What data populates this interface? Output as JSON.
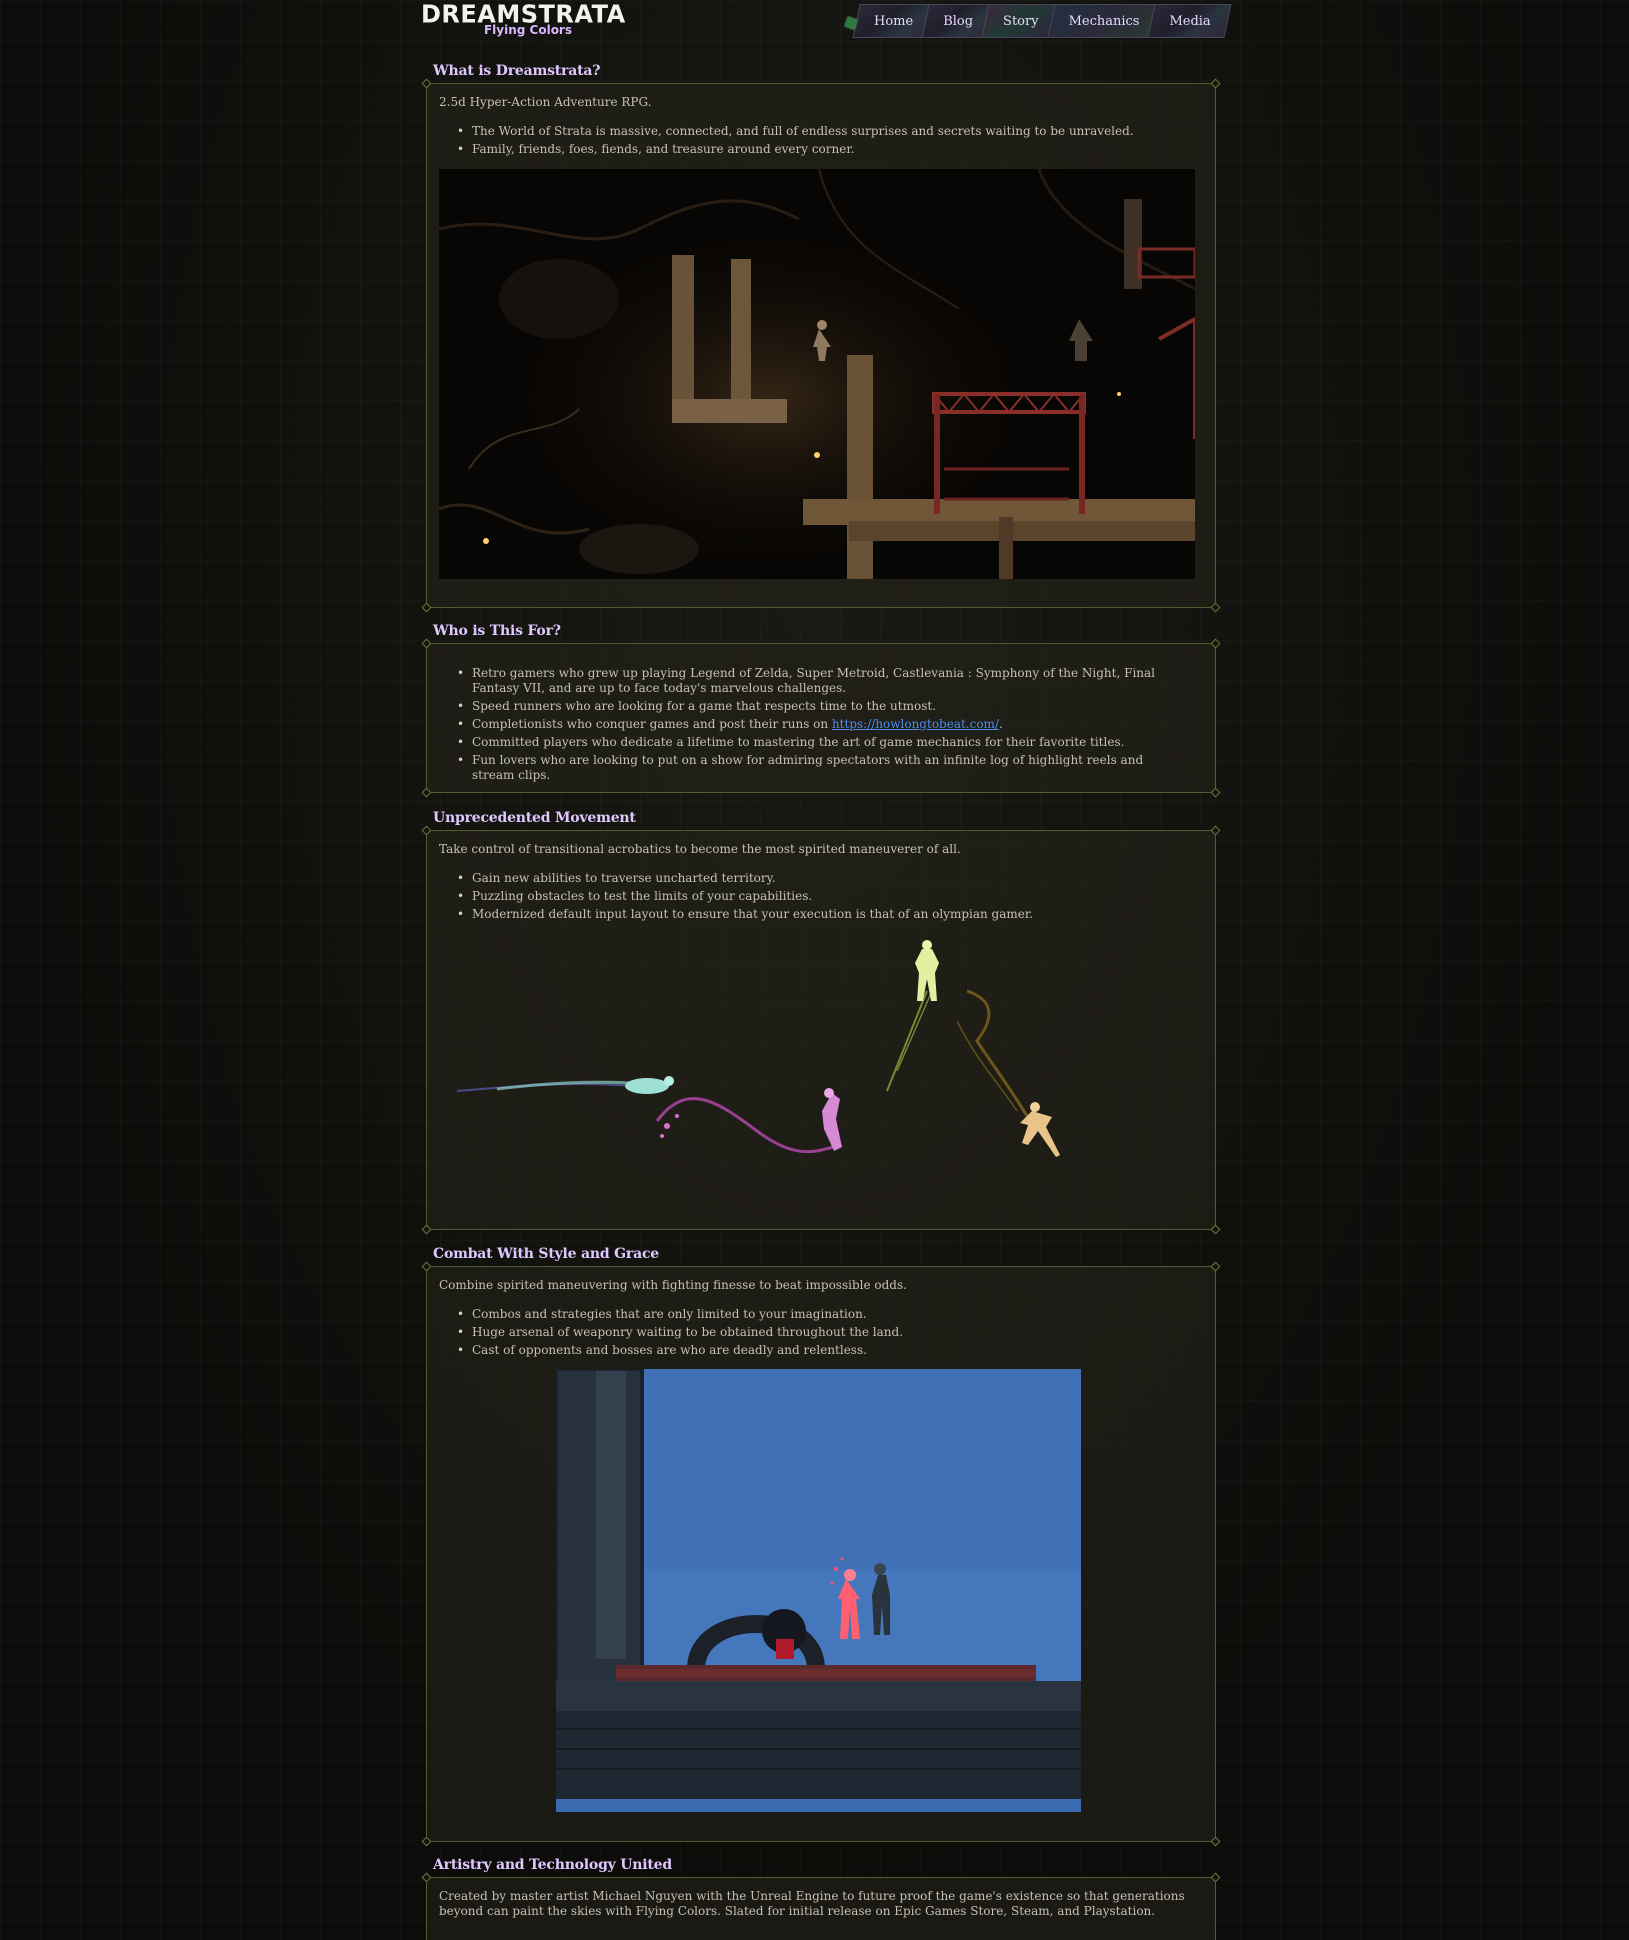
{
  "header": {
    "logo_title": "DREAMSTRATA",
    "logo_subtitle": "Flying Colors",
    "nav": [
      "Home",
      "Blog",
      "Story",
      "Mechanics",
      "Media"
    ]
  },
  "sections": {
    "what": {
      "title": "What is Dreamstrata?",
      "lead": "2.5d Hyper-Action Adventure RPG.",
      "bullets": [
        "The World of Strata is massive, connected, and full of endless surprises and secrets waiting to be unraveled.",
        "Family, friends, foes, fiends, and treasure around every corner."
      ]
    },
    "who": {
      "title": "Who is This For?",
      "bullets": [
        "Retro gamers who grew up playing Legend of Zelda, Super Metroid, Castlevania : Symphony of the Night, Final Fantasy VII, and are up to face today's marvelous challenges.",
        "Speed runners who are looking for a game that respects time to the utmost.",
        "Completionists who conquer games and post their runs on",
        "Committed players who dedicate a lifetime to mastering the art of game mechanics for their favorite titles.",
        "Fun lovers who are looking to put on a show for admiring spectators with an infinite log of highlight reels and stream clips."
      ],
      "link": "https://howlongtobeat.com/",
      "link_suffix": "."
    },
    "movement": {
      "title": "Unprecedented Movement",
      "lead": "Take control of transitional acrobatics to become the most spirited maneuverer of all.",
      "bullets": [
        "Gain new abilities to traverse uncharted territory.",
        "Puzzling obstacles to test the limits of your capabilities.",
        "Modernized default input layout to ensure that your execution is that of an olympian gamer."
      ]
    },
    "combat": {
      "title": "Combat With Style and Grace",
      "lead": "Combine spirited maneuvering with fighting finesse to beat impossible odds.",
      "bullets": [
        "Combos and strategies that are only limited to your imagination.",
        "Huge arsenal of weaponry waiting to be obtained throughout the land.",
        "Cast of opponents and bosses are who are deadly and relentless."
      ]
    },
    "artistry": {
      "title": "Artistry and Technology United",
      "lead": "Created by master artist Michael Nguyen with the Unreal Engine to future proof the game's existence so that generations beyond can paint the skies with Flying Colors. Slated for initial release on Epic Games Store, Steam, and Playstation."
    }
  },
  "colors": {
    "background": "#0c0c0a",
    "heading": "#e0c8ff",
    "panel_border": "#545b2c",
    "link": "#4d8ef0"
  }
}
